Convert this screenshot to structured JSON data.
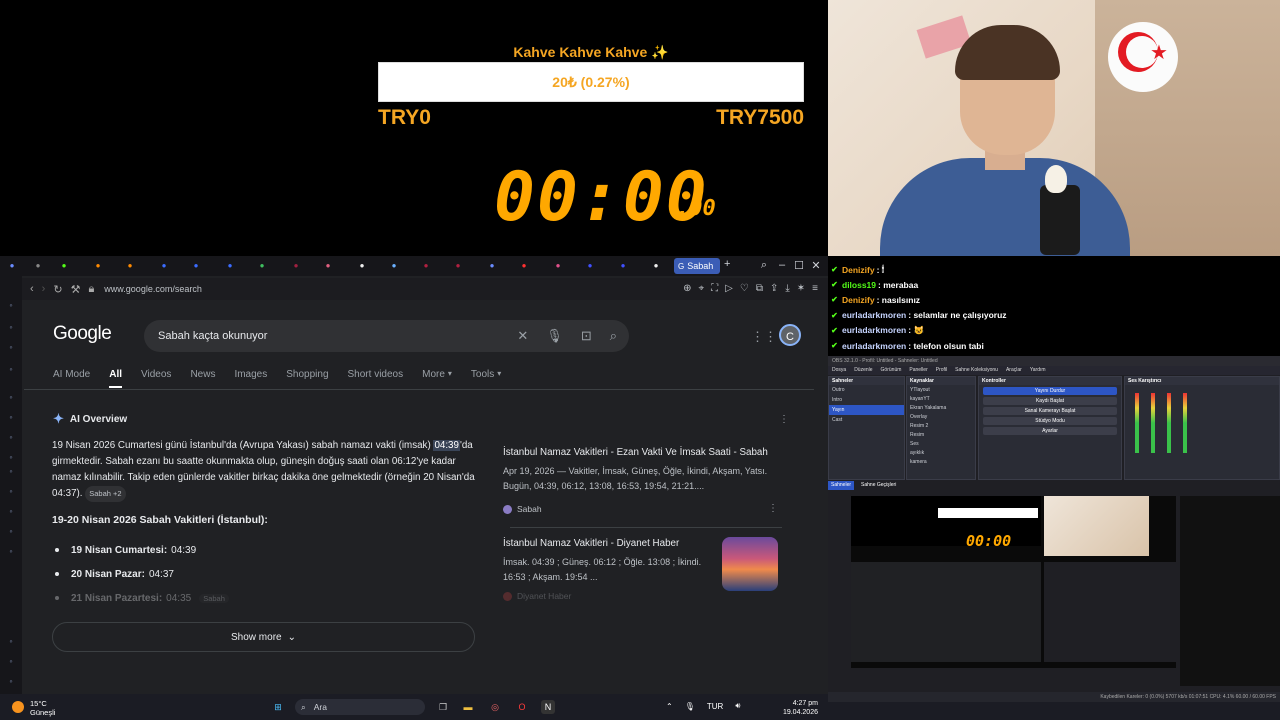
{
  "overlay": {
    "goal_title": "Kahve Kahve Kahve ✨",
    "goal_progress_text": "20₺ (0.27%)",
    "goal_progress_fraction": 0.0027,
    "goal_min": "TRY0",
    "goal_max": "TRY7500",
    "timer_main": "00:00",
    "timer_ms": ".00"
  },
  "chat": {
    "messages": [
      {
        "user": "Denizify",
        "user_color": "#f5a623",
        "text": "🕯"
      },
      {
        "user": "diloss19",
        "user_color": "#53fc18",
        "text": "merabaa"
      },
      {
        "user": "Denizify",
        "user_color": "#f5a623",
        "text": "nasılsınız"
      },
      {
        "user": "eurladarkmoren",
        "user_color": "#c6d4ff",
        "text": "selamlar ne çalışıyoruz"
      },
      {
        "user": "eurladarkmoren",
        "user_color": "#c6d4ff",
        "text": "😺"
      },
      {
        "user": "eurladarkmoren",
        "user_color": "#c6d4ff",
        "text": "telefon olsun tabi"
      }
    ]
  },
  "browser": {
    "active_tab": "Sabah",
    "url": "www.google.com/search",
    "search_query": "Sabah kaçta okunuyor",
    "avatar_letter": "C",
    "tabs": [
      "AI Mode",
      "All",
      "Videos",
      "News",
      "Images",
      "Shopping",
      "Short videos",
      "More",
      "Tools"
    ],
    "ai_overview_label": "AI Overview",
    "ai_text_1": "19 Nisan 2026 Cumartesi günü İstanbul'da (Avrupa Yakası) sabah namazı vakti (imsak)",
    "ai_highlight": "04:39",
    "ai_text_2": "'da girmektedir. Sabah ezanı bu saatte okunmakta olup, güneşin doğuş saati olan 06:12'ye kadar namaz kılınabilir. Takip eden günlerde vakitler birkaç dakika öne gelmektedir (örneğin 20 Nisan'da 04:37).",
    "ai_chip": "Sabah +2",
    "subheading": "19-20 Nisan 2026 Sabah Vakitleri (İstanbul):",
    "bullets": [
      {
        "day": "19 Nisan Cumartesi:",
        "time": "04:39"
      },
      {
        "day": "20 Nisan Pazar:",
        "time": "04:37"
      },
      {
        "day": "21 Nisan Pazartesi:",
        "time": "04:35"
      }
    ],
    "bullet_chip": "Sabah",
    "show_more": "Show more",
    "sources": [
      {
        "title": "İstanbul Namaz Vakitleri - Ezan Vakti Ve İmsak Saati - Sabah",
        "snippet": "Apr 19, 2026 — Vakitler, İmsak, Güneş, Öğle, İkindi, Akşam, Yatsı. Bugün, 04:39, 06:12, 13:08, 16:53, 19:54, 21:21....",
        "site": "Sabah"
      },
      {
        "title": "İstanbul Namaz Vakitleri - Diyanet Haber",
        "snippet": "İmsak. 04:39 ; Güneş. 06:12 ; Öğle. 13:08 ; İkindi. 16:53 ; Akşam. 19:54 ...",
        "site": "Diyanet Haber"
      }
    ]
  },
  "obs": {
    "title": "OBS 32.1.0 - Profil: Untitled - Sahneler: Untitled",
    "menu": [
      "Dosya",
      "Düzenle",
      "Görünüm",
      "Paneller",
      "Profil",
      "Sahne Koleksiyonu",
      "Araçlar",
      "Yardım"
    ],
    "scenes_label": "Sahneler",
    "scenes": [
      "Outro",
      "Intro",
      "Yayın",
      "Cast"
    ],
    "sources_label": "Kaynaklar",
    "sources": [
      "YTlayout",
      "kayanYT",
      "Ekran Yakalama",
      "Overlay",
      "Resim 2",
      "Resim",
      "Ses",
      "ayıklık",
      "kamera"
    ],
    "controls_label": "Kontroller",
    "controls": [
      "Yayını Durdur",
      "Kaydı Başlat",
      "Sanal Kamerayı Başlat",
      "Stüdyo Modu",
      "Ayarlar"
    ],
    "mixer_label": "Ses Karıştırıcı",
    "scene_tabs": [
      "Sahneler",
      "Sahne Geçişleri"
    ],
    "status": "Kaybedilen Kareler: 0 (0.0%)   5707 kb/s   01:07:51   CPU: 4.1%  60.00 / 60.00 FPS"
  },
  "taskbar": {
    "temp": "15°C",
    "weather": "Güneşli",
    "search_label": "Ara",
    "lang": "TUR",
    "time": "4:27 pm",
    "date": "19.04.2026"
  }
}
